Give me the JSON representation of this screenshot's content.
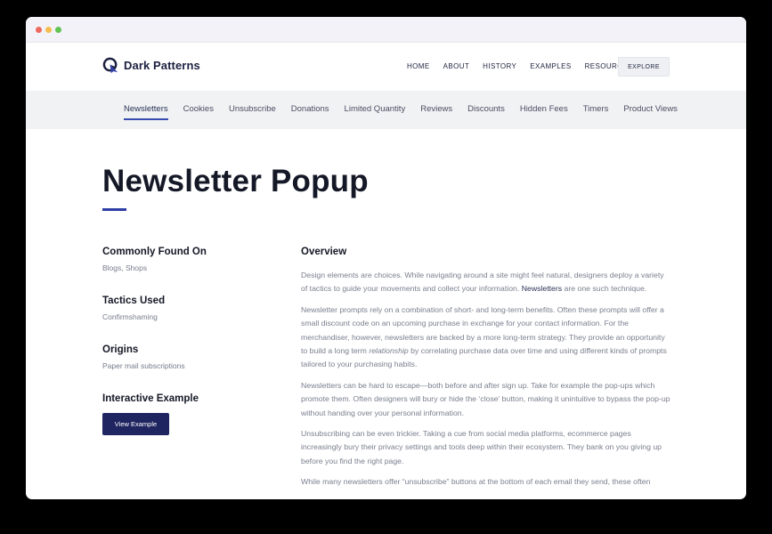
{
  "window": {
    "controls": [
      "close",
      "minimize",
      "maximize"
    ]
  },
  "header": {
    "logo_text": "Dark Patterns",
    "nav": [
      "HOME",
      "ABOUT",
      "HISTORY",
      "EXAMPLES",
      "RESOURCES"
    ],
    "explore_label": "EXPLORE"
  },
  "subnav": {
    "items": [
      "Newsletters",
      "Cookies",
      "Unsubscribe",
      "Donations",
      "Limited Quantity",
      "Reviews",
      "Discounts",
      "Hidden Fees",
      "Timers",
      "Product Views"
    ],
    "active": "Newsletters"
  },
  "page": {
    "title": "Newsletter Popup"
  },
  "sidebar": {
    "commonly_found_heading": "Commonly Found On",
    "commonly_found_value": "Blogs, Shops",
    "tactics_heading": "Tactics Used",
    "tactics_value": "Confirmshaming",
    "origins_heading": "Origins",
    "origins_value": "Paper mail subscriptions",
    "interactive_heading": "Interactive Example",
    "view_example_label": "View Example"
  },
  "overview": {
    "heading": "Overview",
    "p1_before": "Design elements are choices. While navigating around a site might feel natural, designers deploy a variety of tactics to guide your movements and collect your information. ",
    "p1_highlight": "Newsletters",
    "p1_after": " are one such technique.",
    "p2_before": "Newsletter prompts rely on a combination of short- and long-term benefits. Often these prompts will offer a small discount code on an upcoming purchase in exchange for your contact information. For the merchandiser, however, newsletters are backed by a more long-term strategy. They provide an opportunity to build a long term ",
    "p2_em": "relationship",
    "p2_after": " by correlating purchase data over time and using different kinds of prompts tailored to your purchasing habits.",
    "p3": "Newsletters can be hard to escape—both before and after sign up. Take for example the pop-ups which promote them. Often designers will bury or hide the ‘close’ button, making it unintuitive to bypass the pop-up without handing over your personal information.",
    "p4": "Unsubscribing can be even trickier. Taking a cue from social media platforms, ecommerce pages increasingly bury their privacy settings and tools deep within their ecosystem. They bank on you giving up before you find the right page.",
    "p5": " While many newsletters offer “unsubscribe” buttons at the bottom of each email they send, these often"
  },
  "colors": {
    "accent": "#2f3fa5",
    "button_dark": "#1f2560",
    "title": "#151826",
    "body_text": "#7a7f8e"
  }
}
